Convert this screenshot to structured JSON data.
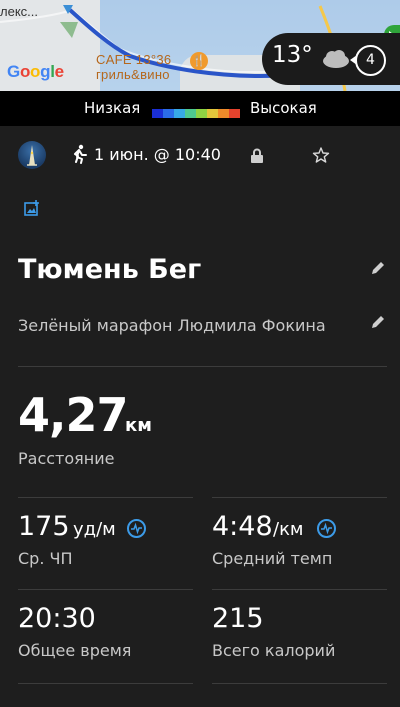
{
  "map": {
    "top_text": "лекс...",
    "cafe_line1": "CAFE 13°36",
    "cafe_line2": "гриль&вино",
    "google_logo": "Google",
    "weather": {
      "temperature": "13°",
      "wind_speed": "4",
      "icon": "cloud-icon"
    }
  },
  "legend": {
    "low_label": "Низкая",
    "high_label": "Высокая",
    "gradient_colors": [
      "#1a2fd6",
      "#2b6ce8",
      "#37a9e6",
      "#4ec98f",
      "#8fd343",
      "#e2c63b",
      "#ee8b2a",
      "#e5432d"
    ]
  },
  "activity": {
    "type_icon": "running-icon",
    "date_time": "1 июн. @ 10:40",
    "title": "Тюмень Бег",
    "description": "Зелёный марафон Людмила Фокина"
  },
  "distance": {
    "value": "4,27",
    "unit": "км",
    "label": "Расстояние"
  },
  "stats": {
    "avg_cadence": {
      "value": "175",
      "unit": "уд/м",
      "label": "Ср. ЧП"
    },
    "avg_pace": {
      "value": "4:48",
      "unit": "/км",
      "label": "Средний темп"
    },
    "total_time": {
      "value": "20:30",
      "label": "Общее время"
    },
    "calories": {
      "value": "215",
      "label": "Всего калорий"
    }
  },
  "colors": {
    "accent": "#3c9be8",
    "background": "#1e1e1e",
    "route": "#2a55c8"
  }
}
